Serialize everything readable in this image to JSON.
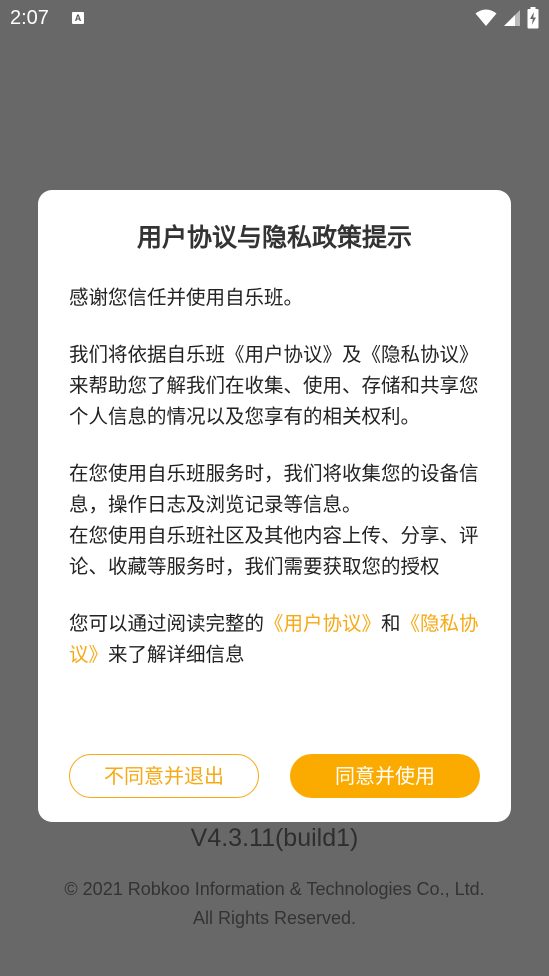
{
  "status_bar": {
    "time": "2:07",
    "notification_icon": "a-badge-icon",
    "icons": [
      "wifi-icon",
      "signal-icon",
      "battery-icon"
    ]
  },
  "dialog": {
    "title": "用户协议与隐私政策提示",
    "paragraph1": "感谢您信任并使用自乐班。",
    "paragraph2": {
      "prefix": "我们将依据自乐班《用户协议》及《隐私协议》来帮助您了解我们在收集、使用、存储和共享您个人信息的情况以及您享有的相关权利。"
    },
    "paragraph3_line1": "在您使用自乐班服务时，我们将收集您的设备信息，操作日志及浏览记录等信息。",
    "paragraph3_line2": "在您使用自乐班社区及其他内容上传、分享、评论、收藏等服务时，我们需要获取您的授权",
    "paragraph4": {
      "part1": "您可以通过阅读完整的",
      "link_user_agreement": "《用户协议》",
      "part2": "和",
      "link_privacy": "《隐私协议》",
      "part3": "来了解详细信息"
    },
    "decline_button": "不同意并退出",
    "agree_button": "同意并使用"
  },
  "background": {
    "version": "V4.3.11(build1)",
    "copyright_line1": "© 2021 Robkoo Information & Technologies Co., Ltd.",
    "copyright_line2": "All Rights Reserved."
  },
  "colors": {
    "accent": "#fbab00",
    "link": "#f6a913",
    "overlay": "#686868"
  }
}
